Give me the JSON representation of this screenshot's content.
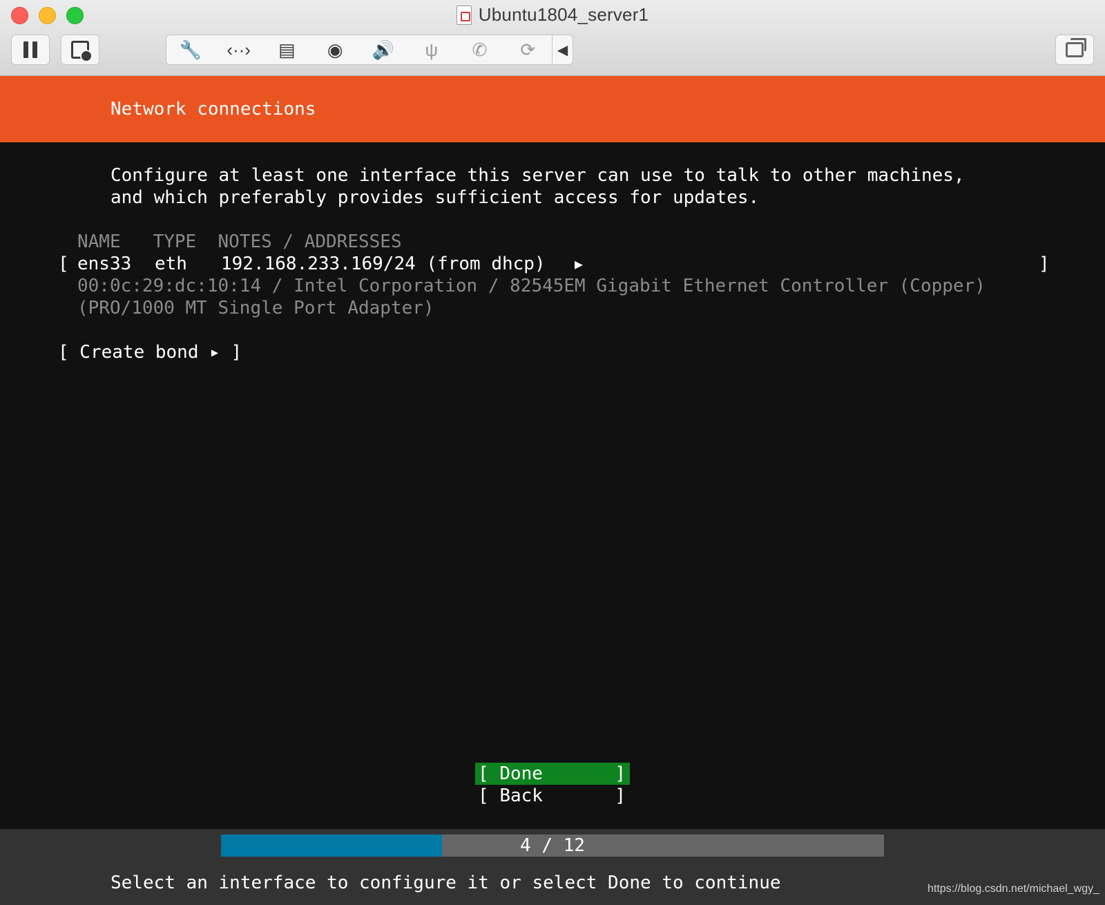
{
  "window": {
    "title": "Ubuntu1804_server1"
  },
  "toolbar": {
    "icons": [
      "pause-icon",
      "snapshot-icon",
      "settings-wrench-icon",
      "network-icon",
      "hard-disk-icon",
      "cd-dvd-icon",
      "sound-icon",
      "usb-icon",
      "phone-icon",
      "sync-icon",
      "collapse-arrow-icon",
      "fullscreen-window-icon"
    ]
  },
  "installer": {
    "header": "Network connections",
    "intro_line1": "Configure at least one interface this server can use to talk to other machines,",
    "intro_line2": "and which preferably provides sufficient access for updates.",
    "columns_header": "NAME   TYPE  NOTES / ADDRESSES",
    "interfaces": [
      {
        "name": "ens33",
        "type": "eth",
        "address": "192.168.233.169/24 (from dhcp)",
        "detail_line1": "00:0c:29:dc:10:14 / Intel Corporation / 82545EM Gigabit Ethernet Controller (Copper)",
        "detail_line2": "(PRO/1000 MT Single Port Adapter)"
      }
    ],
    "create_bond": "[ Create bond ▸ ]",
    "done_label": "Done",
    "back_label": "Back",
    "progress": {
      "current": 4,
      "total": 12,
      "text": "4 / 12"
    },
    "footer_hint": "Select an interface to configure it or select Done to continue"
  },
  "colors": {
    "header": "#e95420",
    "done_button": "#0e8420",
    "progress_fill": "#0079a7",
    "progress_track": "#666666"
  },
  "watermark": "https://blog.csdn.net/michael_wgy_"
}
